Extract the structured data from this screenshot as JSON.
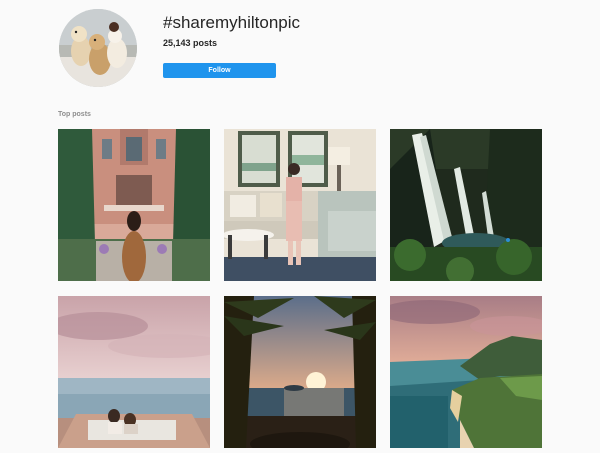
{
  "hashtag": {
    "title": "#sharemyhiltonpic",
    "post_count": "25,143 posts",
    "follow_label": "Follow",
    "avatar_icon": "dogs-on-couch-photo"
  },
  "section": {
    "top_posts_label": "Top posts"
  },
  "posts": [
    {
      "photo": "woman-in-ornate-garden-photo"
    },
    {
      "photo": "woman-in-hotel-room-photo"
    },
    {
      "photo": "waterfall-jungle-photo"
    },
    {
      "photo": "couple-on-deck-pink-sky-photo"
    },
    {
      "photo": "palm-trees-sunset-photo"
    },
    {
      "photo": "coastline-aerial-sunset-photo"
    }
  ],
  "colors": {
    "background": "#fafafa",
    "follow_button": "#1f94ed",
    "secondary_text": "#8e8e8e"
  }
}
